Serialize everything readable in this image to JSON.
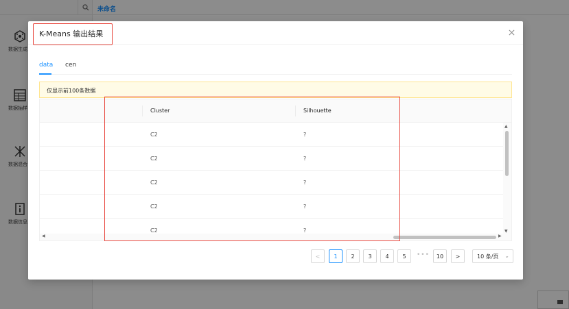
{
  "background": {
    "canvas_tab": "未命名",
    "tools": [
      {
        "icon": "cube-icon",
        "label": "数据生成"
      },
      {
        "icon": "table-icon",
        "label": "数据抽样"
      },
      {
        "icon": "merge-icon",
        "label": "数据混合"
      },
      {
        "icon": "info-icon",
        "label": "数据信息"
      }
    ]
  },
  "modal": {
    "title": "K-Means 输出结果",
    "close_label": "×",
    "tabs": [
      {
        "label": "data",
        "active": true
      },
      {
        "label": "cen",
        "active": false
      }
    ],
    "notice": "仅显示前100条数据",
    "table": {
      "columns": [
        "",
        "Cluster",
        "Silhouette"
      ],
      "rows": [
        [
          "",
          "C2",
          "?"
        ],
        [
          "",
          "C2",
          "?"
        ],
        [
          "",
          "C2",
          "?"
        ],
        [
          "",
          "C2",
          "?"
        ],
        [
          "",
          "C2",
          "?"
        ]
      ]
    },
    "pagination": {
      "prev": "<",
      "pages": [
        "1",
        "2",
        "3",
        "4",
        "5"
      ],
      "current": "1",
      "ellipsis": "•••",
      "last": "10",
      "next": ">",
      "page_size": "10 条/页"
    }
  },
  "colors": {
    "accent": "#1890ff",
    "highlight": "#e8453c",
    "notice_bg": "#fffbe6"
  }
}
